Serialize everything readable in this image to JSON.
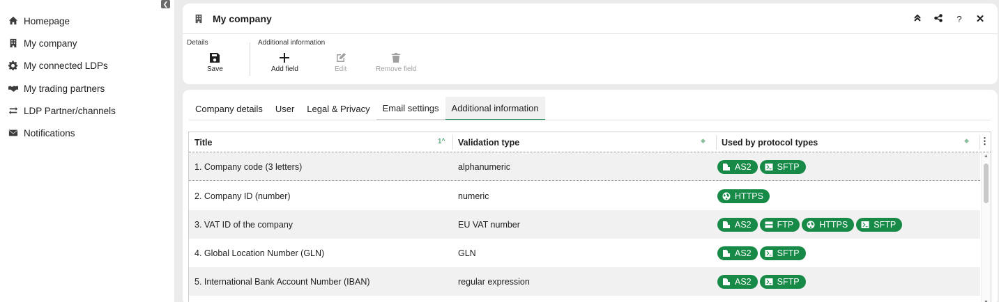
{
  "sidebar": {
    "items": [
      {
        "label": "Homepage",
        "icon": "home-icon"
      },
      {
        "label": "My company",
        "icon": "building-icon"
      },
      {
        "label": "My connected LDPs",
        "icon": "gear-icon"
      },
      {
        "label": "My trading partners",
        "icon": "handshake-icon"
      },
      {
        "label": "LDP Partner/channels",
        "icon": "swap-arrows-icon"
      },
      {
        "label": "Notifications",
        "icon": "envelope-icon"
      }
    ]
  },
  "header": {
    "title": "My company",
    "actions": [
      "collapse-up-icon",
      "share-icon",
      "help-icon",
      "close-icon"
    ],
    "help_label": "?",
    "close_label": "✕"
  },
  "toolbar": {
    "details_label": "Details",
    "additional_label": "Additional information",
    "save_label": "Save",
    "add_field_label": "Add field",
    "edit_label": "Edit",
    "remove_field_label": "Remove field"
  },
  "tabs": [
    "Company details",
    "User",
    "Legal & Privacy",
    "Email settings",
    "Additional information"
  ],
  "active_tab": "Additional information",
  "grid": {
    "columns": {
      "title": "Title",
      "validation": "Validation type",
      "protocols": "Used by protocol types"
    },
    "sort_indicator": "1",
    "rows": [
      {
        "title": "1. Company code (3 letters)",
        "validation": "alphanumeric",
        "protocols": [
          "AS2",
          "SFTP"
        ]
      },
      {
        "title": "2. Company ID (number)",
        "validation": "numeric",
        "protocols": [
          "HTTPS"
        ]
      },
      {
        "title": "3. VAT ID of the company",
        "validation": "EU VAT number",
        "protocols": [
          "AS2",
          "FTP",
          "HTTPS",
          "SFTP"
        ]
      },
      {
        "title": "4. Global Location Number (GLN)",
        "validation": "GLN",
        "protocols": [
          "AS2",
          "SFTP"
        ]
      },
      {
        "title": "5. International Bank Account Number (IBAN)",
        "validation": "regular expression",
        "protocols": [
          "AS2",
          "SFTP"
        ]
      }
    ]
  },
  "colors": {
    "accent": "#168a46",
    "background": "#ebebeb"
  }
}
